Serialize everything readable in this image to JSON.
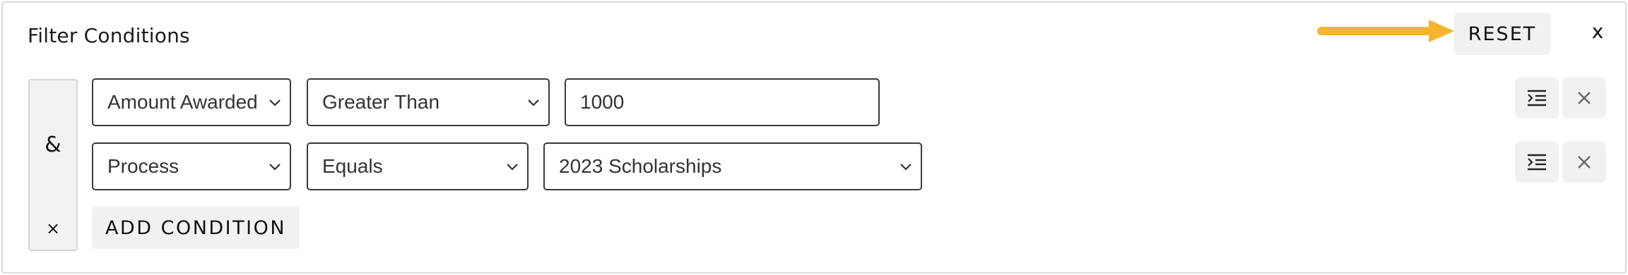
{
  "header": {
    "title": "Filter Conditions",
    "reset_label": "RESET",
    "close_label": "x",
    "arrow_color": "#F5B52E"
  },
  "group": {
    "conjunction_label": "&",
    "remove_label": "×"
  },
  "conditions": [
    {
      "field": "Amount Awarded",
      "operator": "Greater Than",
      "value": "1000",
      "value_type": "text"
    },
    {
      "field": "Process",
      "operator": "Equals",
      "value": "2023 Scholarships",
      "value_type": "select"
    }
  ],
  "add_condition_label": "ADD CONDITION"
}
